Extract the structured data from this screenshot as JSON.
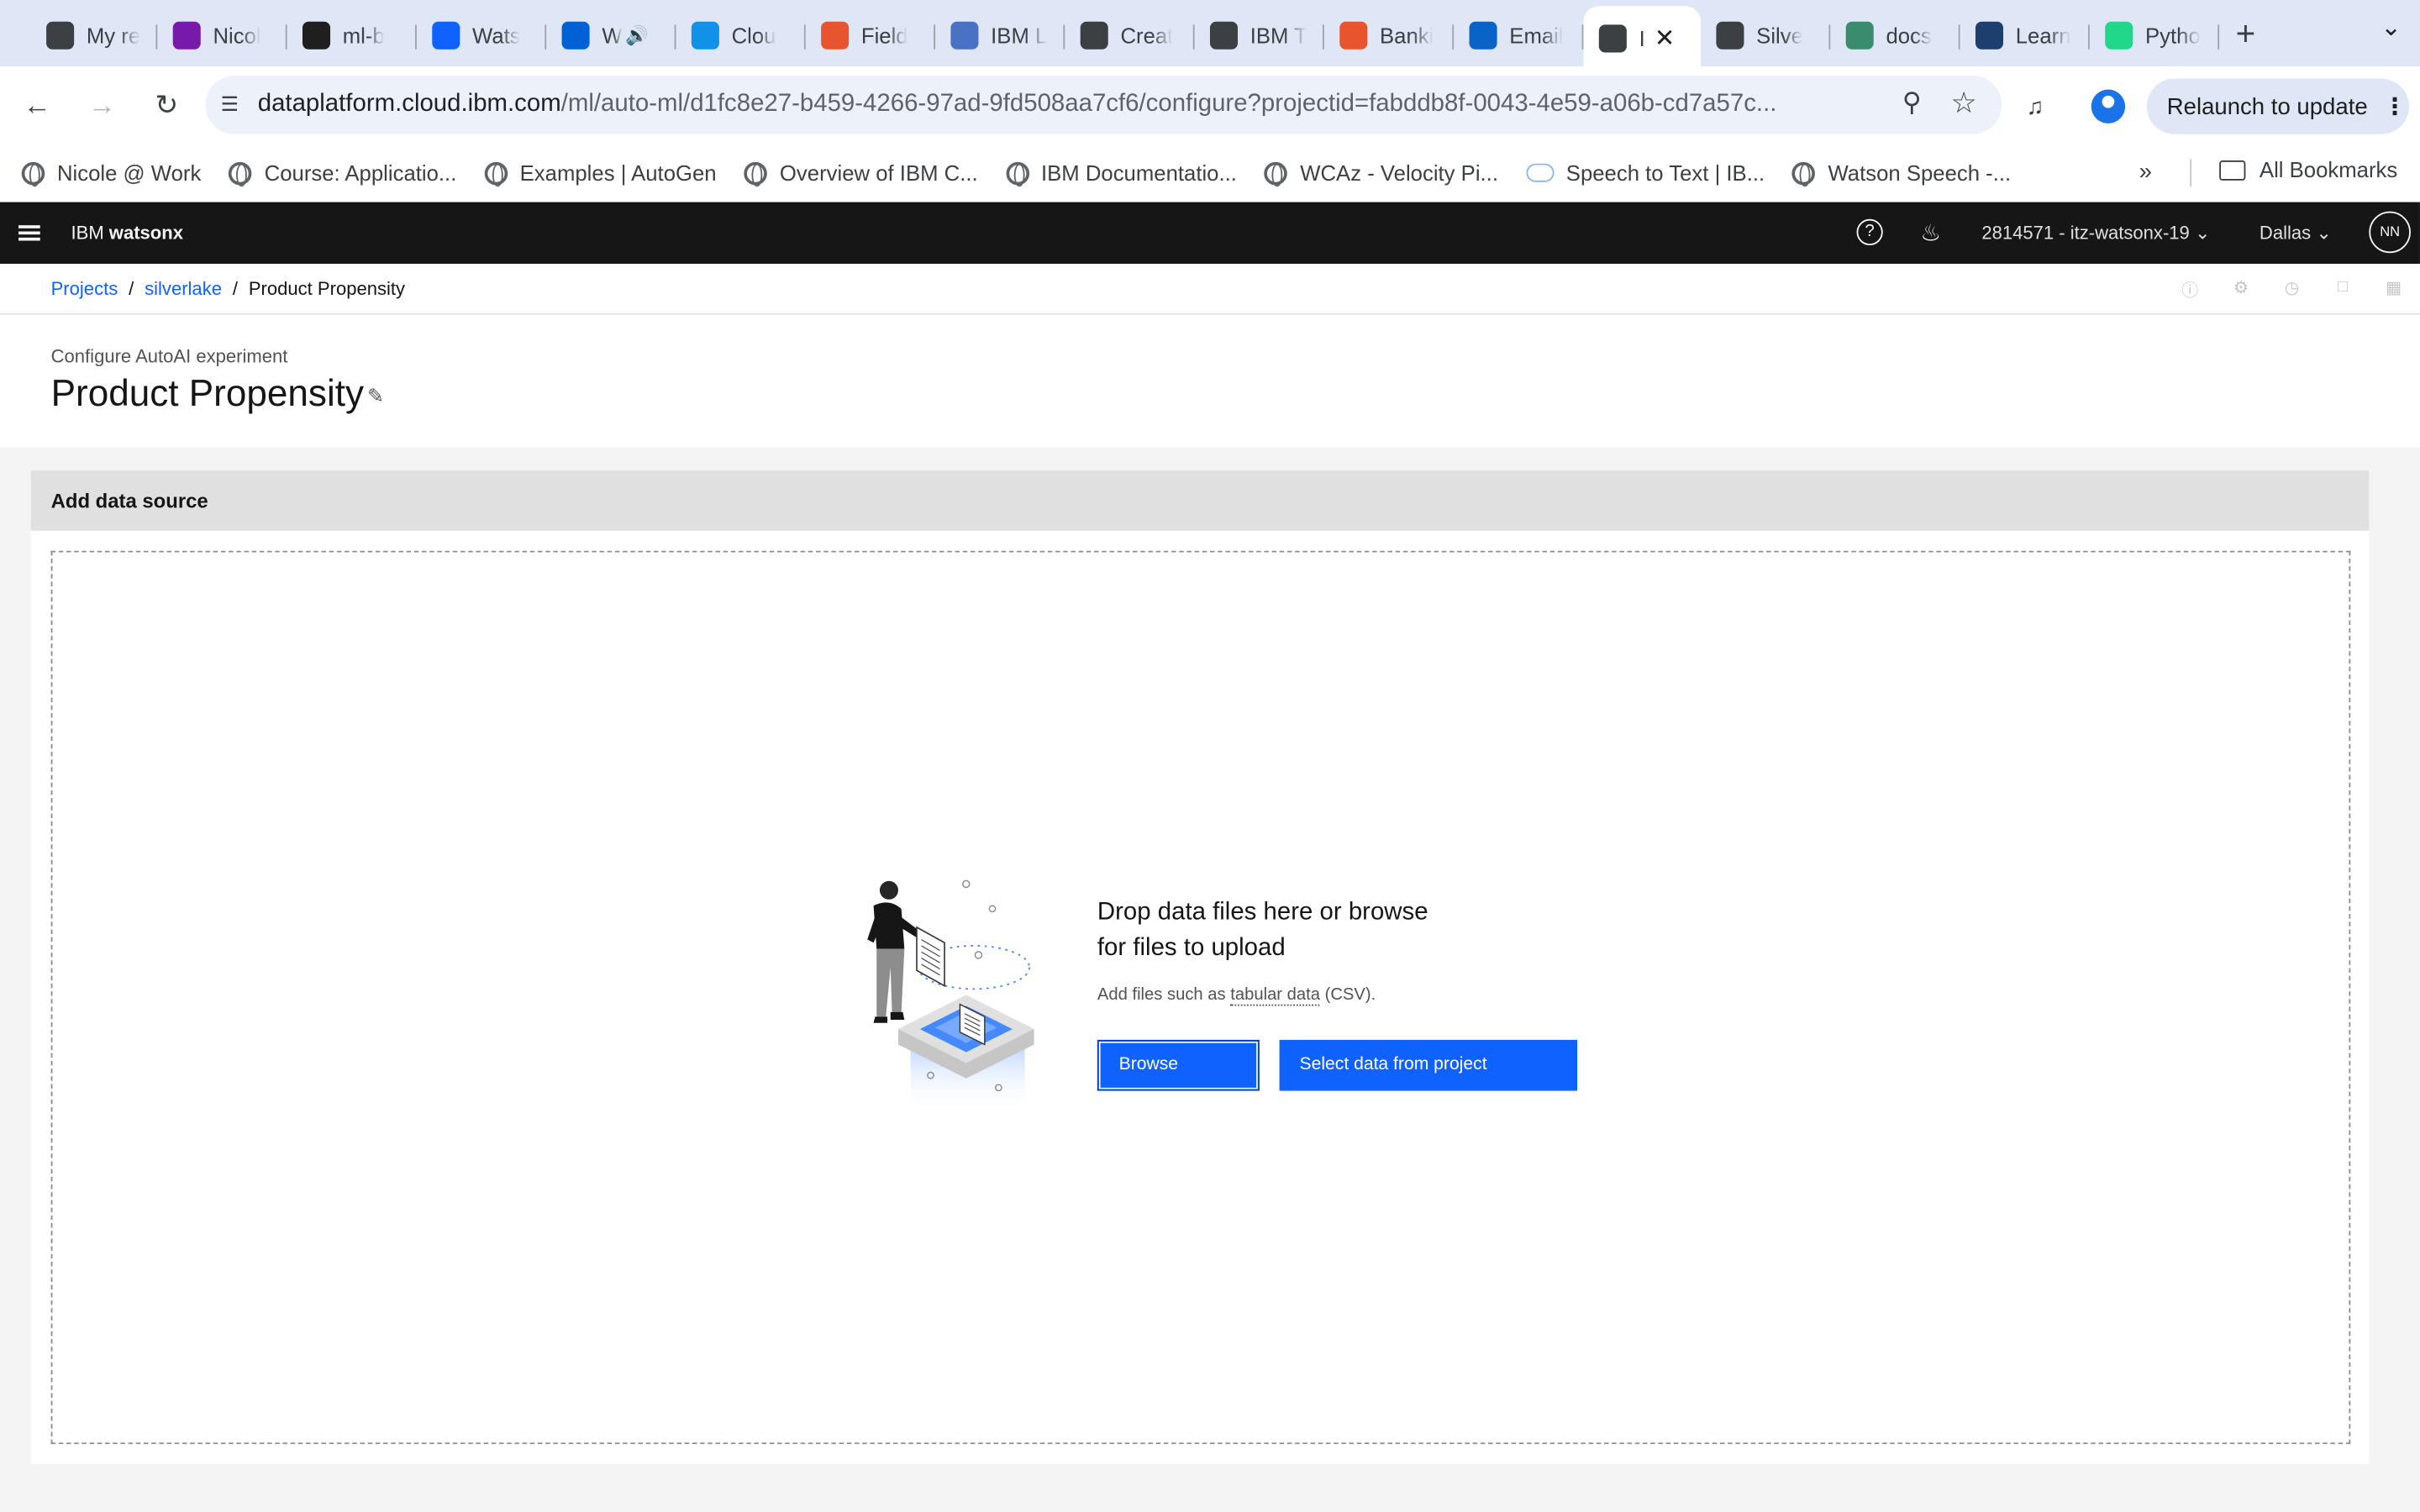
{
  "browser": {
    "tabs": [
      {
        "label": "My re",
        "icon": "watson-bee-icon",
        "color": "#3c4043"
      },
      {
        "label": "Nicol",
        "icon": "onenote-icon",
        "color": "#7719aa"
      },
      {
        "label": "ml-b",
        "icon": "github-icon",
        "color": "#1f1f1f"
      },
      {
        "label": "Wats",
        "icon": "watson-assistant-icon",
        "color": "#0f62fe"
      },
      {
        "label": "W",
        "icon": "box-icon",
        "color": "#0061d5"
      },
      {
        "label": "Clou",
        "icon": "cloud-sparkle-icon",
        "color": "#1192e8"
      },
      {
        "label": "Field",
        "icon": "field-flag-icon",
        "color": "#e8542e"
      },
      {
        "label": "IBM L",
        "icon": "ibm-learning-icon",
        "color": "#4a72c4"
      },
      {
        "label": "Creat",
        "icon": "watson-bee-icon",
        "color": "#3c4043"
      },
      {
        "label": "IBM T",
        "icon": "watson-bee-icon",
        "color": "#3c4043"
      },
      {
        "label": "Banki",
        "icon": "field-flag-icon",
        "color": "#e8542e"
      },
      {
        "label": "Email",
        "icon": "outlook-icon",
        "color": "#0a64c8"
      },
      {
        "label": "I",
        "icon": "globe-icon",
        "color": "#3c4043",
        "active": true
      },
      {
        "label": "Silve",
        "icon": "watson-bee-icon",
        "color": "#3c4043"
      },
      {
        "label": "docs",
        "icon": "docs-leaf-icon",
        "color": "#3b8c6e"
      },
      {
        "label": "Learn",
        "icon": "yl-icon",
        "color": "#1d3f6e"
      },
      {
        "label": "Pytho",
        "icon": "pycharm-icon",
        "color": "#21d789"
      }
    ],
    "url_host": "dataplatform.cloud.ibm.com",
    "url_path": "/ml/auto-ml/d1fc8e27-b459-4266-97ad-9fd508aa7cf6/configure?projectid=fabddb8f-0043-4e59-a06b-cd7a57c...",
    "relaunch_label": "Relaunch to update",
    "bookmarks": [
      {
        "label": "Nicole @ Work",
        "icon": "globe-icon"
      },
      {
        "label": "Course: Applicatio...",
        "icon": "globe-icon"
      },
      {
        "label": "Examples | AutoGen",
        "icon": "globe-icon"
      },
      {
        "label": "Overview of IBM C...",
        "icon": "globe-icon"
      },
      {
        "label": "IBM Documentatio...",
        "icon": "globe-icon"
      },
      {
        "label": "WCAz - Velocity Pi...",
        "icon": "globe-icon"
      },
      {
        "label": "Speech to Text | IB...",
        "icon": "cloud-icon"
      },
      {
        "label": "Watson Speech -...",
        "icon": "globe-icon"
      }
    ],
    "all_bookmarks_label": "All Bookmarks"
  },
  "app": {
    "brand_prefix": "IBM ",
    "brand_name": "watsonx",
    "account": "2814571 - itz-watsonx-19",
    "region": "Dallas",
    "avatar_initials": "NN"
  },
  "breadcrumb": {
    "projects": "Projects",
    "project": "silverlake",
    "current": "Product Propensity"
  },
  "page": {
    "subtitle": "Configure AutoAI experiment",
    "title": "Product Propensity"
  },
  "datasource": {
    "header": "Add data source",
    "drop_title": "Drop data files here or browse for files to upload",
    "drop_sub_prefix": "Add files such as ",
    "drop_sub_link": "tabular data",
    "drop_sub_suffix": " (CSV).",
    "browse_label": "Browse",
    "select_label": "Select data from project"
  },
  "colors": {
    "primary": "#0f62fe",
    "header_bg": "#161616",
    "tabstrip_bg": "#dfe7f6"
  }
}
